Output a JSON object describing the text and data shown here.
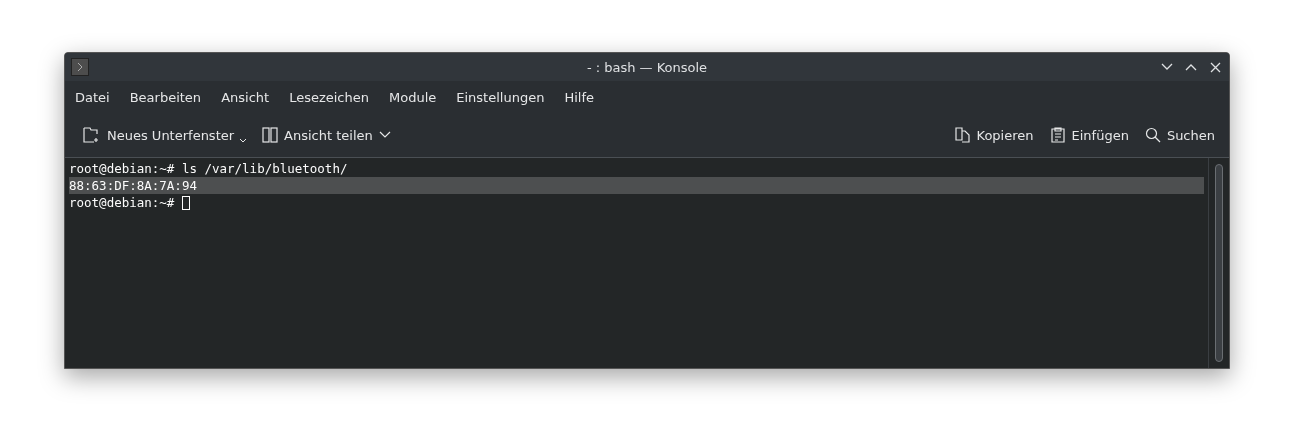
{
  "window": {
    "title": "- : bash — Konsole"
  },
  "menu": [
    "Datei",
    "Bearbeiten",
    "Ansicht",
    "Lesezeichen",
    "Module",
    "Einstellungen",
    "Hilfe"
  ],
  "toolbar_left": [
    {
      "kind": "new-tab",
      "label": "Neues Unterfenster"
    },
    {
      "kind": "split",
      "label": "Ansicht teilen"
    }
  ],
  "toolbar_right": [
    {
      "kind": "copy",
      "label": "Kopieren"
    },
    {
      "kind": "paste",
      "label": "Einfügen"
    },
    {
      "kind": "search",
      "label": "Suchen"
    }
  ],
  "terminal": {
    "lines": [
      {
        "text": "root@debian:~# ls /var/lib/bluetooth/",
        "selected": false,
        "cursor": false
      },
      {
        "text": "88:63:DF:8A:7A:94",
        "selected": true,
        "cursor": false
      },
      {
        "text": "root@debian:~# ",
        "selected": false,
        "cursor": true
      }
    ]
  }
}
